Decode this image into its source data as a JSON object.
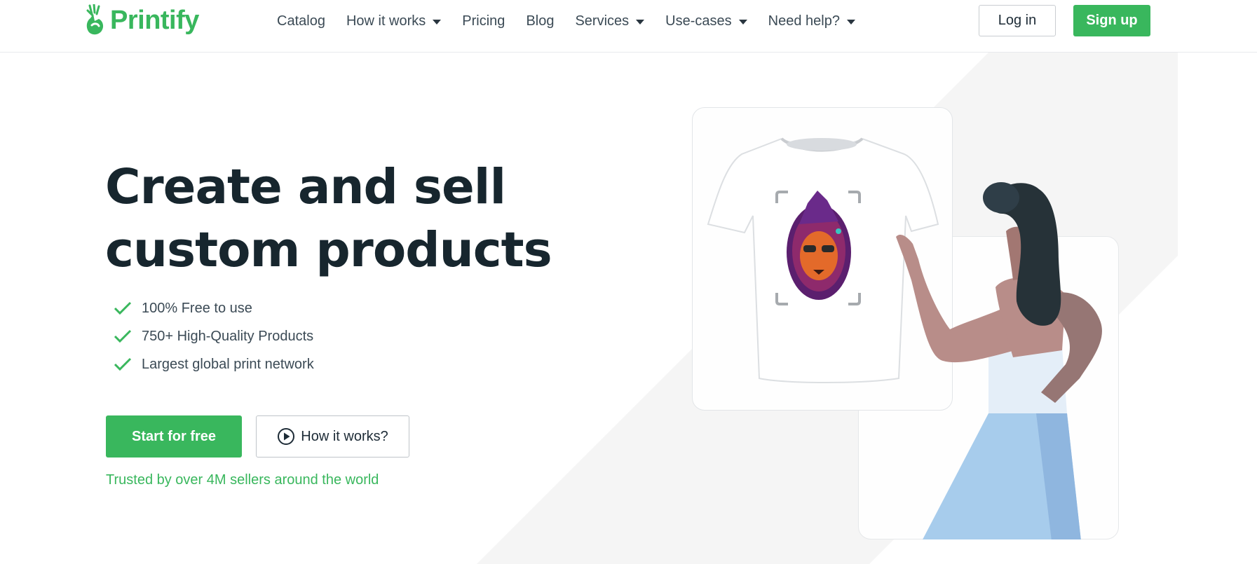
{
  "brand": {
    "name": "Printify",
    "color": "#39b75d"
  },
  "nav": {
    "items": [
      {
        "label": "Catalog",
        "dropdown": false
      },
      {
        "label": "How it works",
        "dropdown": true
      },
      {
        "label": "Pricing",
        "dropdown": false
      },
      {
        "label": "Blog",
        "dropdown": false
      },
      {
        "label": "Services",
        "dropdown": true
      },
      {
        "label": "Use-cases",
        "dropdown": true
      },
      {
        "label": "Need help?",
        "dropdown": true
      }
    ]
  },
  "auth": {
    "login_label": "Log in",
    "signup_label": "Sign up"
  },
  "hero": {
    "title_line1": "Create and sell",
    "title_line2": "custom products",
    "features": [
      "100% Free to use",
      "750+ High-Quality Products",
      "Largest global print network"
    ],
    "cta_primary": "Start for free",
    "cta_secondary": "How it works?",
    "trusted": "Trusted by over 4M sellers around the world"
  },
  "icons": {
    "feature_icon": "check-icon",
    "secondary_cta_icon": "play-circle-icon",
    "nav_dropdown_icon": "caret-down-icon"
  },
  "colors": {
    "accent": "#39b75d",
    "heading": "#17262e",
    "text": "#3b4a55",
    "background_shape": "#f5f5f5"
  }
}
